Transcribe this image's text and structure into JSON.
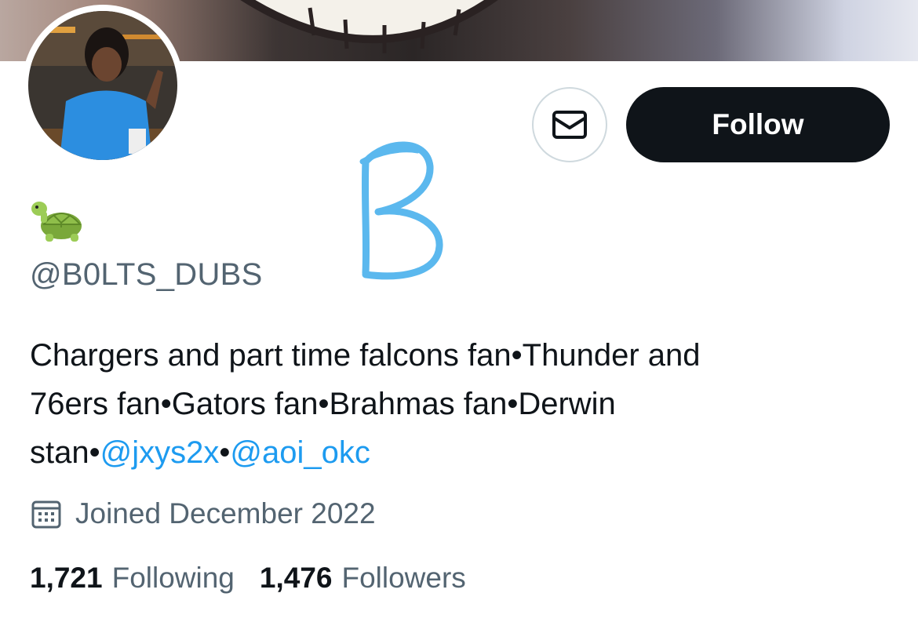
{
  "profile": {
    "display_name_emoji": "🐢",
    "handle": "@B0LTS_DUBS",
    "bio": {
      "line1": "Chargers and part time falcons fan•Thunder and",
      "line2": "76ers fan•Gators fan•Brahmas fan•Derwin",
      "line3_text": "stan•",
      "mention1": "@jxys2x",
      "sep": "•",
      "mention2": "@aoi_okc"
    },
    "joined": "Joined December 2022",
    "following_count": "1,721",
    "following_label": "Following",
    "followers_count": "1,476",
    "followers_label": "Followers"
  },
  "actions": {
    "message_icon": "envelope-icon",
    "follow_label": "Follow"
  },
  "icons": {
    "calendar": "calendar-icon"
  },
  "colors": {
    "link": "#1d9bf0",
    "secondary_text": "#536471",
    "primary_text": "#0f1419",
    "follow_bg": "#0f1419",
    "scribble": "#5bb8ee"
  }
}
